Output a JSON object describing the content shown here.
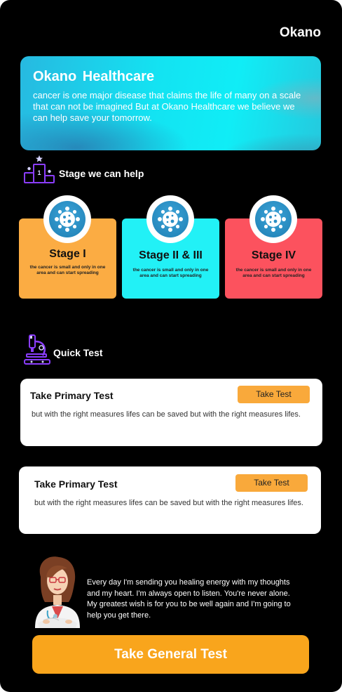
{
  "app": {
    "brand": "Okano"
  },
  "hero": {
    "title": "Okano  Healthcare",
    "text": "cancer is one major disease that claims the life of many on a scale that can not be imagined  But at Okano Healthcare we believe we can help save your tomorrow."
  },
  "stages_section": {
    "title": "Stage we can help",
    "icon": "podium-icon"
  },
  "stages": [
    {
      "name": "Stage I",
      "desc": "the cancer is small and only in one area and can start spreading",
      "color": "#fbac43"
    },
    {
      "name": "Stage II & III",
      "desc": "the cancer is small and only in one area and can start spreading",
      "color": "#22f1f6"
    },
    {
      "name": "Stage IV",
      "desc": "the cancer is small and only in one area and can start spreading",
      "color": "#fc525e"
    }
  ],
  "quick_section": {
    "title": "Quick Test",
    "icon": "microscope-icon"
  },
  "tests": [
    {
      "title": "Take Primary Test",
      "button": "Take Test",
      "desc": "but with the right measures lifes can be saved but with the right measures lifes."
    },
    {
      "title": "Take Primary Test",
      "button": "Take Test",
      "desc": "but with the right measures lifes can be saved but with the right measures lifes."
    }
  ],
  "doctor": {
    "icon": "doctor-avatar",
    "message": "Every day I'm sending you healing energy with my thoughts and my heart. I'm always open to listen. You're never alone. My greatest wish is for you to be well again and I'm going to help you get there."
  },
  "cta": {
    "label": "Take General Test"
  },
  "colors": {
    "accent": "#f9a51c",
    "background": "#000000",
    "cyan": "#13e3f2",
    "icon_purple": "#8b3dff"
  }
}
